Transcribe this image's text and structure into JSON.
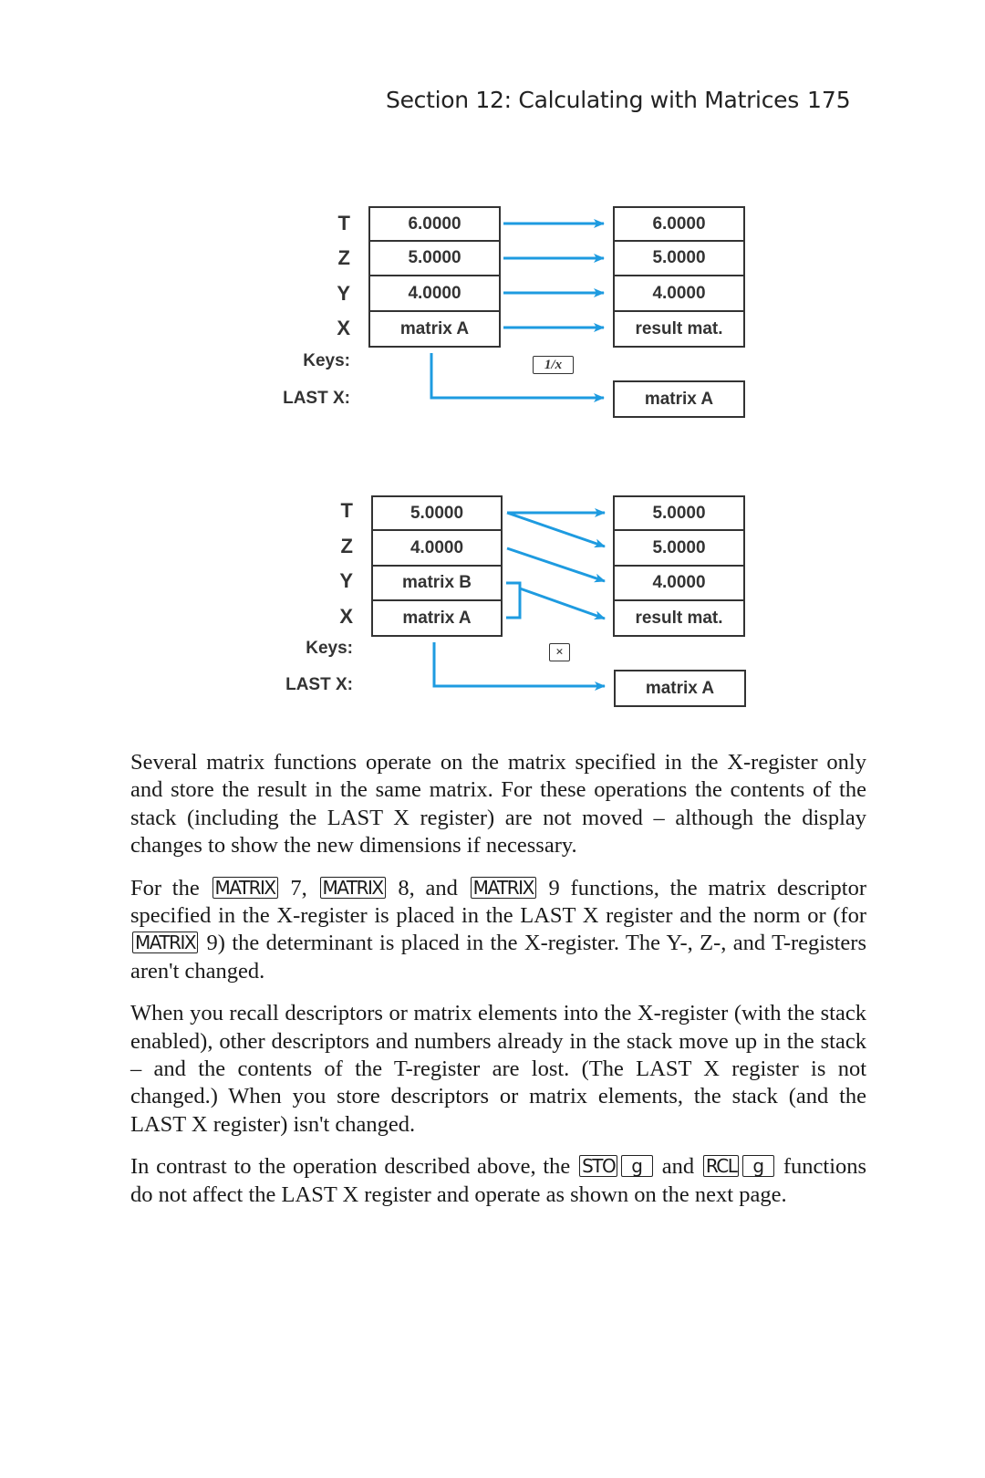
{
  "header": {
    "section_title": "Section 12: Calculating with Matrices",
    "page_number": "175"
  },
  "colors": {
    "arrow": "#1e9be0",
    "box_border": "#333333",
    "text": "#1a1a1a"
  },
  "diagrams": [
    {
      "register_labels": [
        "T",
        "Z",
        "Y",
        "X"
      ],
      "before": [
        "6.0000",
        "5.0000",
        "4.0000",
        "matrix A"
      ],
      "after": [
        "6.0000",
        "5.0000",
        "4.0000",
        "result mat."
      ],
      "keys_label": "Keys:",
      "key": "1/x",
      "last_x_label": "LAST X:",
      "last_x_value": "matrix A",
      "arrow_mapping": "straight"
    },
    {
      "register_labels": [
        "T",
        "Z",
        "Y",
        "X"
      ],
      "before": [
        "5.0000",
        "4.0000",
        "matrix B",
        "matrix A"
      ],
      "after": [
        "5.0000",
        "5.0000",
        "4.0000",
        "result mat."
      ],
      "keys_label": "Keys:",
      "key": "×",
      "last_x_label": "LAST X:",
      "last_x_value": "matrix A",
      "arrow_mapping": "stack-drop"
    }
  ],
  "paragraphs": {
    "p1": "Several matrix functions operate on the matrix specified in the X-register only and store the result in the same matrix. For these operations the contents of the stack (including the LAST X register) are not moved – although the display changes to show the new dimensions if necessary.",
    "p2": {
      "t1": "For the",
      "k1": "MATRIX",
      "t2": "7,",
      "k2": "MATRIX",
      "t3": "8, and",
      "k3": "MATRIX",
      "t4": "9 functions, the matrix descriptor specified in the X-register is placed in the LAST X register and the norm or (for",
      "k4": "MATRIX",
      "t5": "9) the determinant is placed in the X-register. The Y-, Z-, and T-registers aren't changed."
    },
    "p3": "When you recall descriptors or matrix elements into the X-register (with the stack enabled), other descriptors and numbers already in the stack move up in the stack – and the contents of the T-register are lost. (The LAST X register is not changed.) When you store descriptors or matrix elements, the stack (and the LAST X register) isn't changed.",
    "p4": {
      "t1": "In contrast to the operation described above, the",
      "k1": "STO",
      "k2": "g",
      "t2": "and",
      "k3": "RCL",
      "k4": "g",
      "t3": "functions do not affect the LAST X register and operate as shown on the next page."
    }
  }
}
